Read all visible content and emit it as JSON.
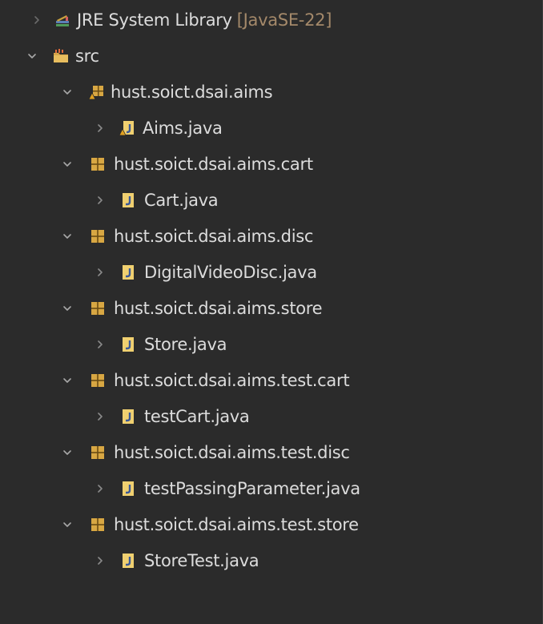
{
  "package_explorer": {
    "items": [
      {
        "label": "JRE System Library",
        "decoration": "[JavaSE-22]",
        "icon": "library-icon",
        "expanded": false
      },
      {
        "label": "src",
        "icon": "source-folder-icon",
        "expanded": true
      },
      {
        "label": "hust.soict.dsai.aims",
        "icon": "package-icon",
        "expanded": true
      },
      {
        "label": "Aims.java",
        "icon": "java-file-icon",
        "expanded": false
      },
      {
        "label": "hust.soict.dsai.aims.cart",
        "icon": "package-icon",
        "expanded": true
      },
      {
        "label": "Cart.java",
        "icon": "java-file-icon",
        "expanded": false
      },
      {
        "label": "hust.soict.dsai.aims.disc",
        "icon": "package-icon",
        "expanded": true
      },
      {
        "label": "DigitalVideoDisc.java",
        "icon": "java-file-icon",
        "expanded": false
      },
      {
        "label": "hust.soict.dsai.aims.store",
        "icon": "package-icon",
        "expanded": true
      },
      {
        "label": "Store.java",
        "icon": "java-file-icon",
        "expanded": false
      },
      {
        "label": "hust.soict.dsai.aims.test.cart",
        "icon": "package-icon",
        "expanded": true
      },
      {
        "label": "testCart.java",
        "icon": "java-file-icon",
        "expanded": false
      },
      {
        "label": "hust.soict.dsai.aims.test.disc",
        "icon": "package-icon",
        "expanded": true
      },
      {
        "label": "testPassingParameter.java",
        "icon": "java-file-icon",
        "expanded": false
      },
      {
        "label": "hust.soict.dsai.aims.test.store",
        "icon": "package-icon",
        "expanded": true
      },
      {
        "label": "StoreTest.java",
        "icon": "java-file-icon",
        "expanded": false
      }
    ]
  },
  "colors": {
    "background": "#2b2b2b",
    "text": "#dcdcdc",
    "decoration": "#a4896a",
    "chevron": "#a8a8a8",
    "package": "#d8a743",
    "java_file": "#f0d070"
  }
}
